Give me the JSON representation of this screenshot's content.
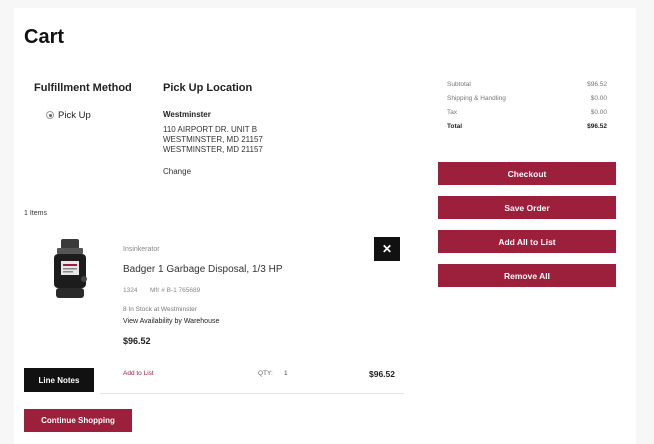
{
  "page": {
    "title": "Cart"
  },
  "fulfillment": {
    "heading": "Fulfillment Method",
    "option_label": "Pick Up"
  },
  "pickup": {
    "heading": "Pick Up Location",
    "store_name": "Westminster",
    "address_line1": "110 AIRPORT DR. UNIT B",
    "address_line2": "WESTMINSTER, MD 21157",
    "address_line3": "WESTMINSTER, MD 21157",
    "change_label": "Change"
  },
  "cart": {
    "items_count_label": "1 Items",
    "item": {
      "brand": "Insinkerator",
      "name": "Badger 1 Garbage Disposal, 1/3 HP",
      "sku": "1324",
      "mfg": "Mfr # B-1 765689",
      "stock": "8 In Stock at Westminster",
      "availability_label": "View Availability by Warehouse",
      "price": "$96.52",
      "add_to_list_label": "Add to List",
      "qty_label": "QTY:",
      "qty_value": "1",
      "line_total": "$96.52",
      "remove_icon": "close-icon"
    },
    "line_notes_label": "Line Notes",
    "continue_label": "Continue Shopping"
  },
  "summary": {
    "subtotal_label": "Subtotal",
    "subtotal_value": "$96.52",
    "shipping_label": "Shipping & Handling",
    "shipping_value": "$0.00",
    "tax_label": "Tax",
    "tax_value": "$0.00",
    "total_label": "Total",
    "total_value": "$96.52"
  },
  "actions": {
    "checkout": "Checkout",
    "save_order": "Save Order",
    "add_all_to_list": "Add All to List",
    "remove_all": "Remove All"
  },
  "colors": {
    "primary": "#9c1f3c",
    "dark": "#111111"
  }
}
